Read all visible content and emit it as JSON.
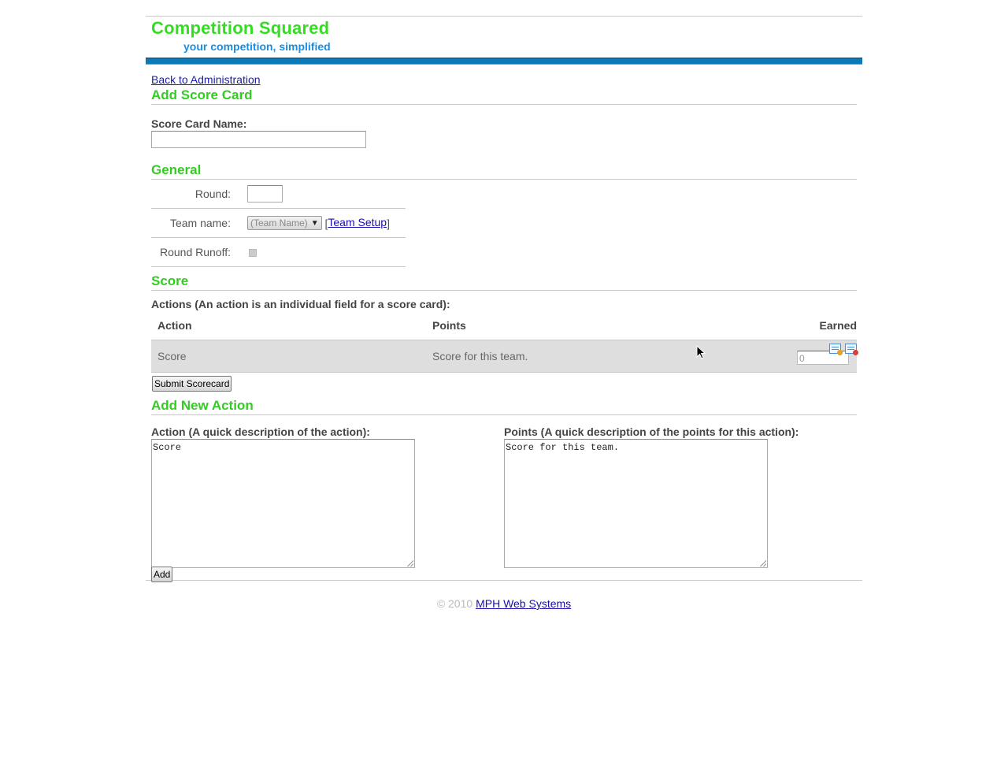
{
  "header": {
    "title": "Competition Squared",
    "tagline": "your competition, simplified"
  },
  "nav": {
    "back_link": "Back to Administration"
  },
  "add_score_card": {
    "heading": "Add Score Card",
    "name_label": "Score Card Name:",
    "name_value": ""
  },
  "general": {
    "heading": "General",
    "round_label": "Round:",
    "round_value": "",
    "team_label": "Team name:",
    "team_selected": "(Team Name)",
    "team_setup_link": "Team Setup",
    "runoff_label": "Round Runoff:"
  },
  "score": {
    "heading": "Score",
    "actions_label": "Actions (An action is an individual field for a score card):",
    "columns": {
      "action": "Action",
      "points": "Points",
      "earned": "Earned"
    },
    "rows": [
      {
        "action": "Score",
        "points": "Score for this team.",
        "earned": "0"
      }
    ],
    "submit_label": "Submit Scorecard"
  },
  "add_action": {
    "heading": "Add New Action",
    "action_label": "Action (A quick description of the action):",
    "action_value": "Score",
    "points_label": "Points (A quick description of the points for this action):",
    "points_value": "Score for this team.",
    "add_label": "Add"
  },
  "footer": {
    "copyright": "© 2010",
    "company_link": "MPH Web Systems"
  },
  "colors": {
    "title_green": "#33dd22",
    "tagline_blue": "#1a8de0",
    "header_bar": "#0a7bb8",
    "row_bg": "#dedede"
  }
}
